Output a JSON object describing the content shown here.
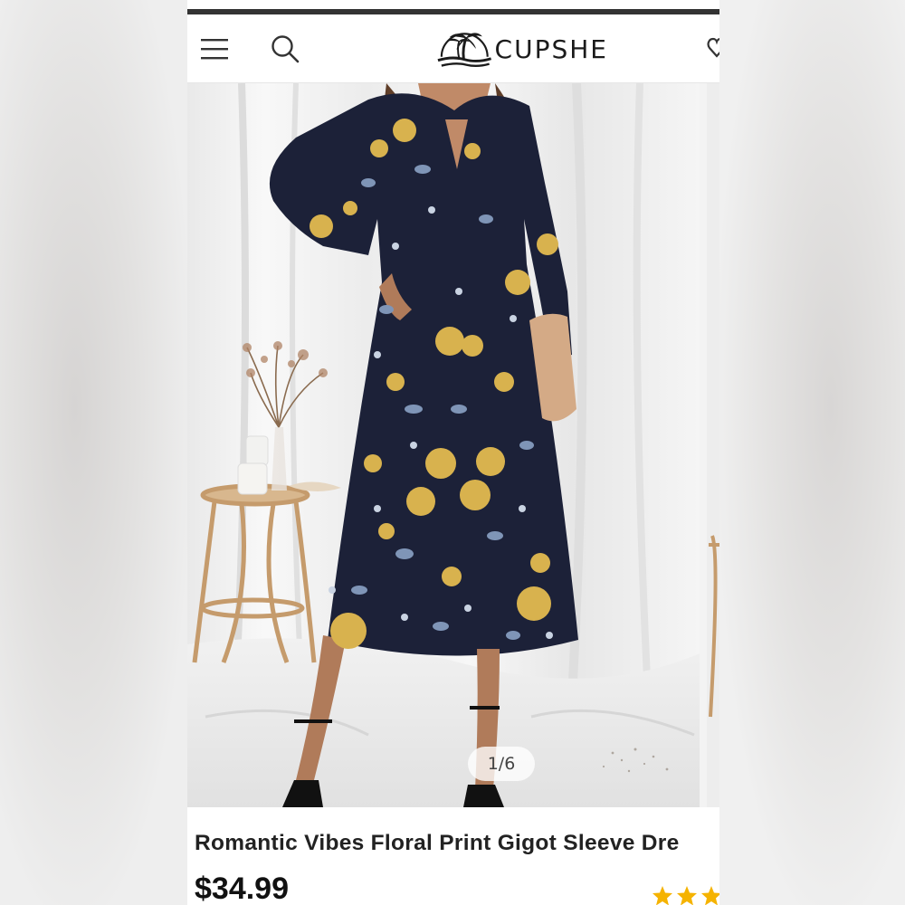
{
  "header": {
    "brand": "CUPSHE"
  },
  "gallery": {
    "counter": "1/6"
  },
  "product": {
    "title": "Romantic Vibes Floral Print Gigot Sleeve Dre",
    "price": "$34.99",
    "rating_stars_visible": 3
  },
  "colors": {
    "dress_navy": "#1c2138",
    "floral_gold": "#d8b24e",
    "floral_blue": "#7f95b7",
    "skin": "#b07b5a",
    "rattan": "#c9a172"
  },
  "icons": [
    "menu-icon",
    "search-icon",
    "palm-logo-icon",
    "heart-icon",
    "star-icon"
  ]
}
